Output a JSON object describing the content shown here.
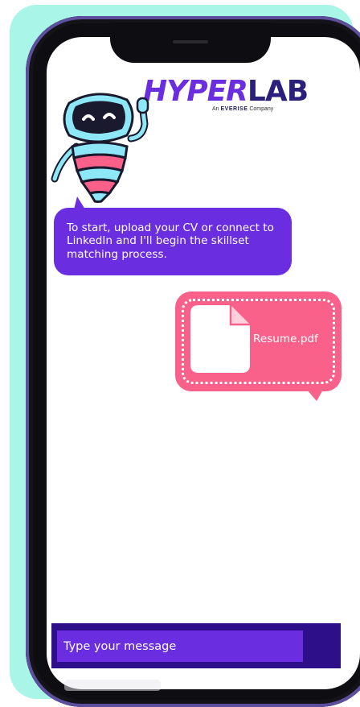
{
  "brand": {
    "logo_hyper": "HYPER",
    "logo_lab": "LAB",
    "tagline_prefix": "An",
    "tagline_company": "EVERISE",
    "tagline_suffix": "Company"
  },
  "chat": {
    "messages": [
      {
        "sender": "bot",
        "text": "To start, upload your CV or connect to LinkedIn and I'll begin the skillset matching process."
      },
      {
        "sender": "user",
        "attachment_name": "Resume.pdf"
      }
    ]
  },
  "composer": {
    "placeholder": "Type your message"
  },
  "colors": {
    "mint": "#a9f5e8",
    "bot_bubble": "#6a2de0",
    "user_bubble": "#f9608a",
    "composer_bar": "#2e0f8a"
  }
}
